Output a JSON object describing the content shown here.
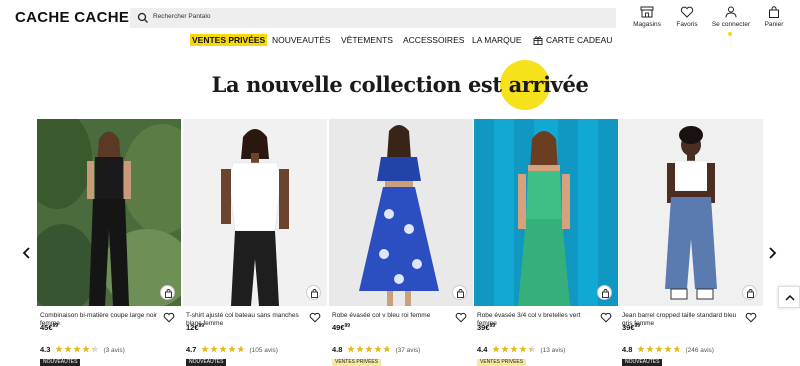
{
  "header": {
    "logo": "CACHE CACHE",
    "search_placeholder": "Rechercher Pantalo",
    "icons": [
      {
        "label": "Magasins",
        "icon": "store-icon"
      },
      {
        "label": "Favoris",
        "icon": "heart-icon"
      },
      {
        "label": "Se connecter",
        "icon": "user-icon"
      },
      {
        "label": "Panier",
        "icon": "bag-icon"
      }
    ]
  },
  "nav": {
    "items": [
      "VENTES PRIVÉES",
      "NOUVEAUTÉS",
      "VÊTEMENTS",
      "ACCESSOIRES",
      "LA MARQUE",
      "CARTE CADEAU"
    ]
  },
  "section_title": "La nouvelle collection est arrivée",
  "colors": {
    "accent_yellow": "#f5d90a",
    "star": "#e8b923"
  },
  "products": [
    {
      "name": "Combinaison bi-matière coupe large noir femme",
      "price": "45€",
      "cents": "99",
      "rating": "4.3",
      "reviews": "(3 avis)",
      "badge": "NOUVEAUTÉS",
      "badge_style": "dark",
      "stars": 4.3
    },
    {
      "name": "T-shirt ajusté col bateau sans manches blanc femme",
      "price": "12€",
      "cents": "99",
      "rating": "4.7",
      "reviews": "(105 avis)",
      "badge": "NOUVEAUTÉS",
      "badge_style": "dark",
      "stars": 4.7
    },
    {
      "name": "Robe évasée col v bleu roi femme",
      "price": "49€",
      "cents": "99",
      "rating": "4.8",
      "reviews": "(37 avis)",
      "badge": "VENTES PRIVÉES",
      "badge_style": "yellow",
      "stars": 4.8
    },
    {
      "name": "Robe évasée 3/4 col v bretelles vert femme",
      "price": "39€",
      "cents": "99",
      "rating": "4.4",
      "reviews": "(13 avis)",
      "badge": "VENTES PRIVÉES",
      "badge_style": "yellow",
      "stars": 4.4
    },
    {
      "name": "Jean barrel cropped taille standard bleu gris femme",
      "price": "39€",
      "cents": "99",
      "rating": "4.8",
      "reviews": "(246 avis)",
      "badge": "NOUVEAUTÉS",
      "badge_style": "dark",
      "stars": 4.8
    }
  ]
}
